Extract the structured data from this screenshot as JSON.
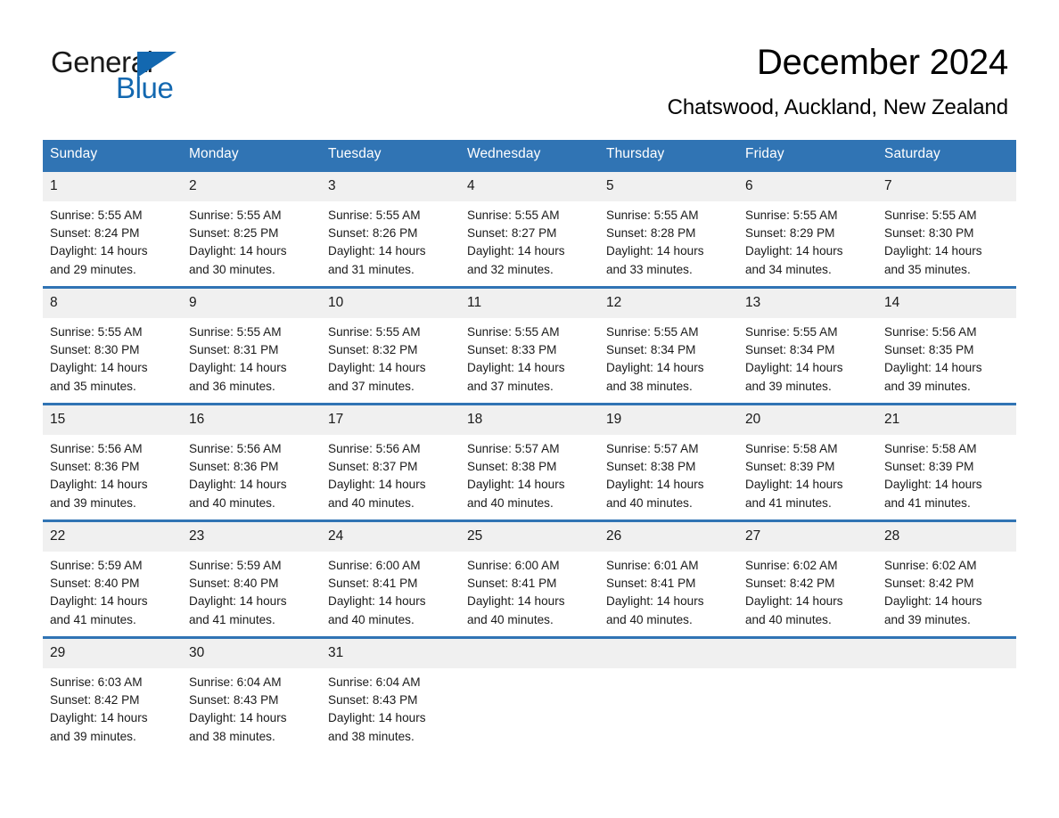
{
  "brand": {
    "name_part1": "General",
    "name_part2": "Blue",
    "triangle_icon": "triangle-icon",
    "accent_color": "#1368b0"
  },
  "header": {
    "title": "December 2024",
    "subtitle": "Chatswood, Auckland, New Zealand"
  },
  "theme": {
    "header_blue": "#3074b4",
    "daynum_bg": "#f0f0f0",
    "text": "#1a1a1a"
  },
  "weekday_headers": [
    "Sunday",
    "Monday",
    "Tuesday",
    "Wednesday",
    "Thursday",
    "Friday",
    "Saturday"
  ],
  "weeks": [
    [
      {
        "day": "1",
        "sunrise": "Sunrise: 5:55 AM",
        "sunset": "Sunset: 8:24 PM",
        "daylight_line1": "Daylight: 14 hours",
        "daylight_line2": "and 29 minutes."
      },
      {
        "day": "2",
        "sunrise": "Sunrise: 5:55 AM",
        "sunset": "Sunset: 8:25 PM",
        "daylight_line1": "Daylight: 14 hours",
        "daylight_line2": "and 30 minutes."
      },
      {
        "day": "3",
        "sunrise": "Sunrise: 5:55 AM",
        "sunset": "Sunset: 8:26 PM",
        "daylight_line1": "Daylight: 14 hours",
        "daylight_line2": "and 31 minutes."
      },
      {
        "day": "4",
        "sunrise": "Sunrise: 5:55 AM",
        "sunset": "Sunset: 8:27 PM",
        "daylight_line1": "Daylight: 14 hours",
        "daylight_line2": "and 32 minutes."
      },
      {
        "day": "5",
        "sunrise": "Sunrise: 5:55 AM",
        "sunset": "Sunset: 8:28 PM",
        "daylight_line1": "Daylight: 14 hours",
        "daylight_line2": "and 33 minutes."
      },
      {
        "day": "6",
        "sunrise": "Sunrise: 5:55 AM",
        "sunset": "Sunset: 8:29 PM",
        "daylight_line1": "Daylight: 14 hours",
        "daylight_line2": "and 34 minutes."
      },
      {
        "day": "7",
        "sunrise": "Sunrise: 5:55 AM",
        "sunset": "Sunset: 8:30 PM",
        "daylight_line1": "Daylight: 14 hours",
        "daylight_line2": "and 35 minutes."
      }
    ],
    [
      {
        "day": "8",
        "sunrise": "Sunrise: 5:55 AM",
        "sunset": "Sunset: 8:30 PM",
        "daylight_line1": "Daylight: 14 hours",
        "daylight_line2": "and 35 minutes."
      },
      {
        "day": "9",
        "sunrise": "Sunrise: 5:55 AM",
        "sunset": "Sunset: 8:31 PM",
        "daylight_line1": "Daylight: 14 hours",
        "daylight_line2": "and 36 minutes."
      },
      {
        "day": "10",
        "sunrise": "Sunrise: 5:55 AM",
        "sunset": "Sunset: 8:32 PM",
        "daylight_line1": "Daylight: 14 hours",
        "daylight_line2": "and 37 minutes."
      },
      {
        "day": "11",
        "sunrise": "Sunrise: 5:55 AM",
        "sunset": "Sunset: 8:33 PM",
        "daylight_line1": "Daylight: 14 hours",
        "daylight_line2": "and 37 minutes."
      },
      {
        "day": "12",
        "sunrise": "Sunrise: 5:55 AM",
        "sunset": "Sunset: 8:34 PM",
        "daylight_line1": "Daylight: 14 hours",
        "daylight_line2": "and 38 minutes."
      },
      {
        "day": "13",
        "sunrise": "Sunrise: 5:55 AM",
        "sunset": "Sunset: 8:34 PM",
        "daylight_line1": "Daylight: 14 hours",
        "daylight_line2": "and 39 minutes."
      },
      {
        "day": "14",
        "sunrise": "Sunrise: 5:56 AM",
        "sunset": "Sunset: 8:35 PM",
        "daylight_line1": "Daylight: 14 hours",
        "daylight_line2": "and 39 minutes."
      }
    ],
    [
      {
        "day": "15",
        "sunrise": "Sunrise: 5:56 AM",
        "sunset": "Sunset: 8:36 PM",
        "daylight_line1": "Daylight: 14 hours",
        "daylight_line2": "and 39 minutes."
      },
      {
        "day": "16",
        "sunrise": "Sunrise: 5:56 AM",
        "sunset": "Sunset: 8:36 PM",
        "daylight_line1": "Daylight: 14 hours",
        "daylight_line2": "and 40 minutes."
      },
      {
        "day": "17",
        "sunrise": "Sunrise: 5:56 AM",
        "sunset": "Sunset: 8:37 PM",
        "daylight_line1": "Daylight: 14 hours",
        "daylight_line2": "and 40 minutes."
      },
      {
        "day": "18",
        "sunrise": "Sunrise: 5:57 AM",
        "sunset": "Sunset: 8:38 PM",
        "daylight_line1": "Daylight: 14 hours",
        "daylight_line2": "and 40 minutes."
      },
      {
        "day": "19",
        "sunrise": "Sunrise: 5:57 AM",
        "sunset": "Sunset: 8:38 PM",
        "daylight_line1": "Daylight: 14 hours",
        "daylight_line2": "and 40 minutes."
      },
      {
        "day": "20",
        "sunrise": "Sunrise: 5:58 AM",
        "sunset": "Sunset: 8:39 PM",
        "daylight_line1": "Daylight: 14 hours",
        "daylight_line2": "and 41 minutes."
      },
      {
        "day": "21",
        "sunrise": "Sunrise: 5:58 AM",
        "sunset": "Sunset: 8:39 PM",
        "daylight_line1": "Daylight: 14 hours",
        "daylight_line2": "and 41 minutes."
      }
    ],
    [
      {
        "day": "22",
        "sunrise": "Sunrise: 5:59 AM",
        "sunset": "Sunset: 8:40 PM",
        "daylight_line1": "Daylight: 14 hours",
        "daylight_line2": "and 41 minutes."
      },
      {
        "day": "23",
        "sunrise": "Sunrise: 5:59 AM",
        "sunset": "Sunset: 8:40 PM",
        "daylight_line1": "Daylight: 14 hours",
        "daylight_line2": "and 41 minutes."
      },
      {
        "day": "24",
        "sunrise": "Sunrise: 6:00 AM",
        "sunset": "Sunset: 8:41 PM",
        "daylight_line1": "Daylight: 14 hours",
        "daylight_line2": "and 40 minutes."
      },
      {
        "day": "25",
        "sunrise": "Sunrise: 6:00 AM",
        "sunset": "Sunset: 8:41 PM",
        "daylight_line1": "Daylight: 14 hours",
        "daylight_line2": "and 40 minutes."
      },
      {
        "day": "26",
        "sunrise": "Sunrise: 6:01 AM",
        "sunset": "Sunset: 8:41 PM",
        "daylight_line1": "Daylight: 14 hours",
        "daylight_line2": "and 40 minutes."
      },
      {
        "day": "27",
        "sunrise": "Sunrise: 6:02 AM",
        "sunset": "Sunset: 8:42 PM",
        "daylight_line1": "Daylight: 14 hours",
        "daylight_line2": "and 40 minutes."
      },
      {
        "day": "28",
        "sunrise": "Sunrise: 6:02 AM",
        "sunset": "Sunset: 8:42 PM",
        "daylight_line1": "Daylight: 14 hours",
        "daylight_line2": "and 39 minutes."
      }
    ],
    [
      {
        "day": "29",
        "sunrise": "Sunrise: 6:03 AM",
        "sunset": "Sunset: 8:42 PM",
        "daylight_line1": "Daylight: 14 hours",
        "daylight_line2": "and 39 minutes."
      },
      {
        "day": "30",
        "sunrise": "Sunrise: 6:04 AM",
        "sunset": "Sunset: 8:43 PM",
        "daylight_line1": "Daylight: 14 hours",
        "daylight_line2": "and 38 minutes."
      },
      {
        "day": "31",
        "sunrise": "Sunrise: 6:04 AM",
        "sunset": "Sunset: 8:43 PM",
        "daylight_line1": "Daylight: 14 hours",
        "daylight_line2": "and 38 minutes."
      },
      {
        "day": "",
        "sunrise": "",
        "sunset": "",
        "daylight_line1": "",
        "daylight_line2": ""
      },
      {
        "day": "",
        "sunrise": "",
        "sunset": "",
        "daylight_line1": "",
        "daylight_line2": ""
      },
      {
        "day": "",
        "sunrise": "",
        "sunset": "",
        "daylight_line1": "",
        "daylight_line2": ""
      },
      {
        "day": "",
        "sunrise": "",
        "sunset": "",
        "daylight_line1": "",
        "daylight_line2": ""
      }
    ]
  ]
}
